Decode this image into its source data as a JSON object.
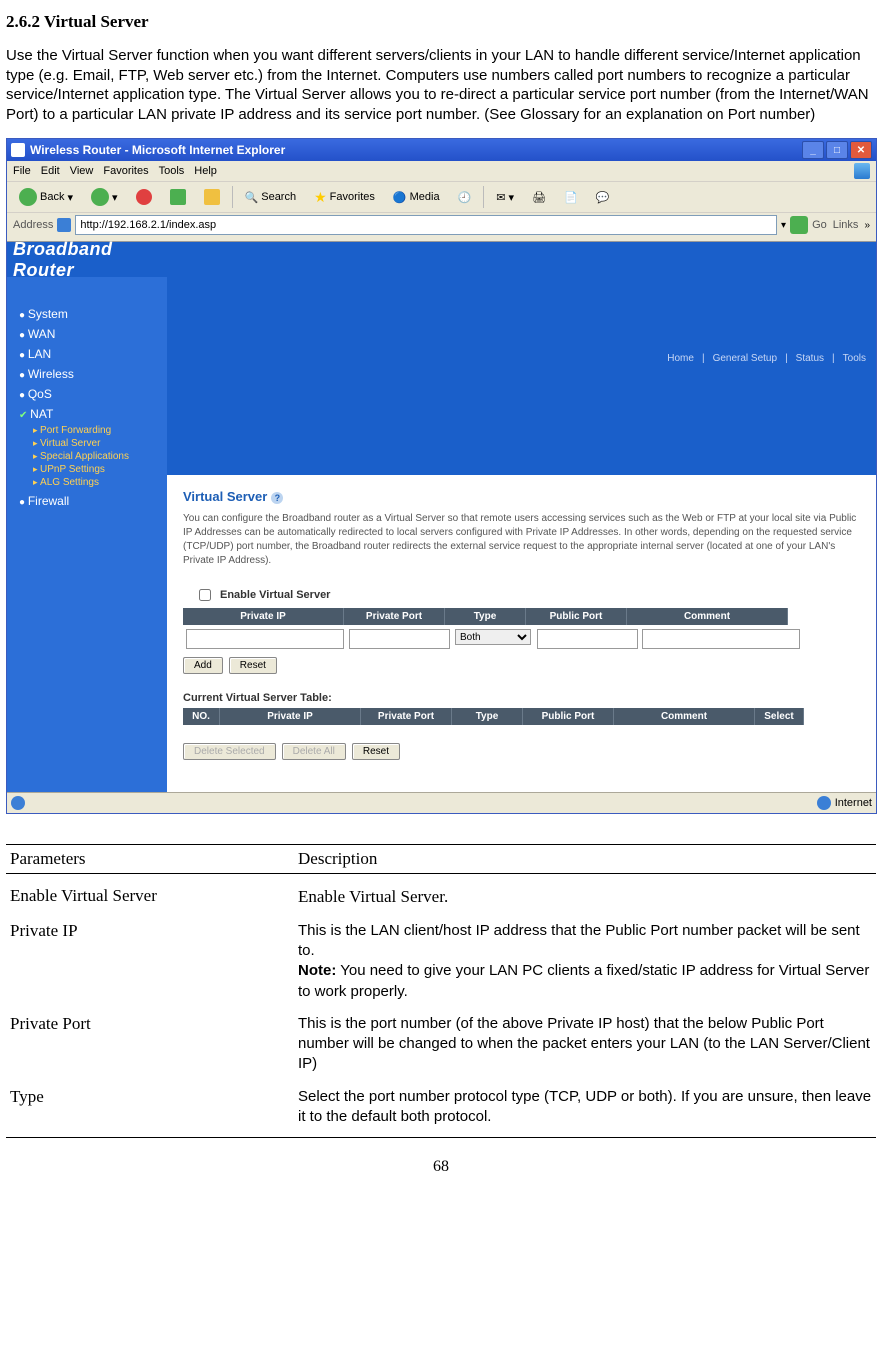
{
  "section": {
    "number": "2.6.2",
    "title": "Virtual Server",
    "intro": "Use the Virtual Server function when you want different servers/clients in your LAN to handle different service/Internet application type (e.g. Email, FTP, Web server etc.) from the Internet. Computers use numbers called port numbers to recognize a particular service/Internet application type. The Virtual Server allows you to re-direct a particular service port number (from the Internet/WAN Port) to a particular LAN private IP address and its service port number. (See Glossary for an explanation on Port number)"
  },
  "browser": {
    "title": "Wireless Router - Microsoft Internet Explorer",
    "menus": [
      "File",
      "Edit",
      "View",
      "Favorites",
      "Tools",
      "Help"
    ],
    "toolbar": {
      "back": "Back",
      "search": "Search",
      "favorites": "Favorites",
      "media": "Media"
    },
    "address_label": "Address",
    "address_value": "http://192.168.2.1/index.asp",
    "go": "Go",
    "links": "Links",
    "status": "Internet"
  },
  "app": {
    "brand": "Broadband Router",
    "toplinks": [
      "Home",
      "General Setup",
      "Status",
      "Tools"
    ],
    "menu": {
      "items": [
        "System",
        "WAN",
        "LAN",
        "Wireless",
        "QoS"
      ],
      "nat": "NAT",
      "subitems": [
        "Port Forwarding",
        "Virtual Server",
        "Special Applications",
        "UPnP Settings",
        "ALG Settings"
      ],
      "firewall": "Firewall"
    },
    "page": {
      "heading": "Virtual Server",
      "description": "You can configure the Broadband router as a Virtual Server so that remote users accessing services such as the Web or FTP at your local site via Public IP Addresses can be automatically redirected to local servers configured with Private IP Addresses. In other words, depending on the requested service (TCP/UDP) port number, the Broadband router redirects the external service request to the appropriate internal server (located at one of your LAN's Private IP Address).",
      "enable_label": "Enable Virtual Server",
      "headers1": [
        "Private IP",
        "Private Port",
        "Type",
        "Public Port",
        "Comment"
      ],
      "type_option": "Both",
      "add_btn": "Add",
      "reset_btn": "Reset",
      "table_title": "Current Virtual Server Table:",
      "headers2": [
        "NO.",
        "Private IP",
        "Private Port",
        "Type",
        "Public Port",
        "Comment",
        "Select"
      ],
      "delete_selected": "Delete Selected",
      "delete_all": "Delete All",
      "reset2": "Reset"
    }
  },
  "params": {
    "col1": "Parameters",
    "col2": "Description",
    "rows": [
      {
        "p": "Enable Virtual Server",
        "d": "Enable Virtual Server."
      },
      {
        "p": "Private IP",
        "d": "This is the LAN client/host IP address that the Public Port number packet will be sent to.",
        "note_label": "Note:",
        "note": " You need to give your LAN PC clients a fixed/static IP address for Virtual Server to work properly."
      },
      {
        "p": "Private Port",
        "d": "This is the port number (of the above Private IP host) that the below Public Port number will be changed to when the packet enters your LAN (to the LAN Server/Client IP)"
      },
      {
        "p": "Type",
        "d": "Select the port number protocol type (TCP, UDP or both). If you are unsure, then leave it to the default both protocol."
      }
    ]
  },
  "page_number": "68"
}
